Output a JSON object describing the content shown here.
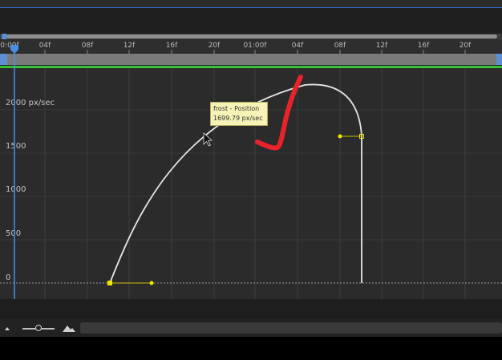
{
  "ruler": {
    "ticks": [
      "0:00f",
      "04f",
      "08f",
      "12f",
      "16f",
      "20f",
      "01:00f",
      "04f",
      "08f",
      "12f",
      "16f",
      "20f"
    ]
  },
  "graph": {
    "value_labels": [
      "2000 px/sec",
      "1500",
      "1000",
      "500",
      "0"
    ]
  },
  "tooltip": {
    "line1": "frost - Position",
    "line2": "1699.79 px/sec"
  },
  "colors": {
    "curve": "#e6e6e6",
    "keyframe": "#f2e600",
    "playhead": "#4a90e2",
    "annotation": "#e8232a",
    "work_area_bar": "#36c236"
  },
  "icons": {
    "zoom_out": "small-mountain-icon",
    "zoom_in": "large-mountain-icon",
    "cursor": "pointer-arrow-icon"
  }
}
